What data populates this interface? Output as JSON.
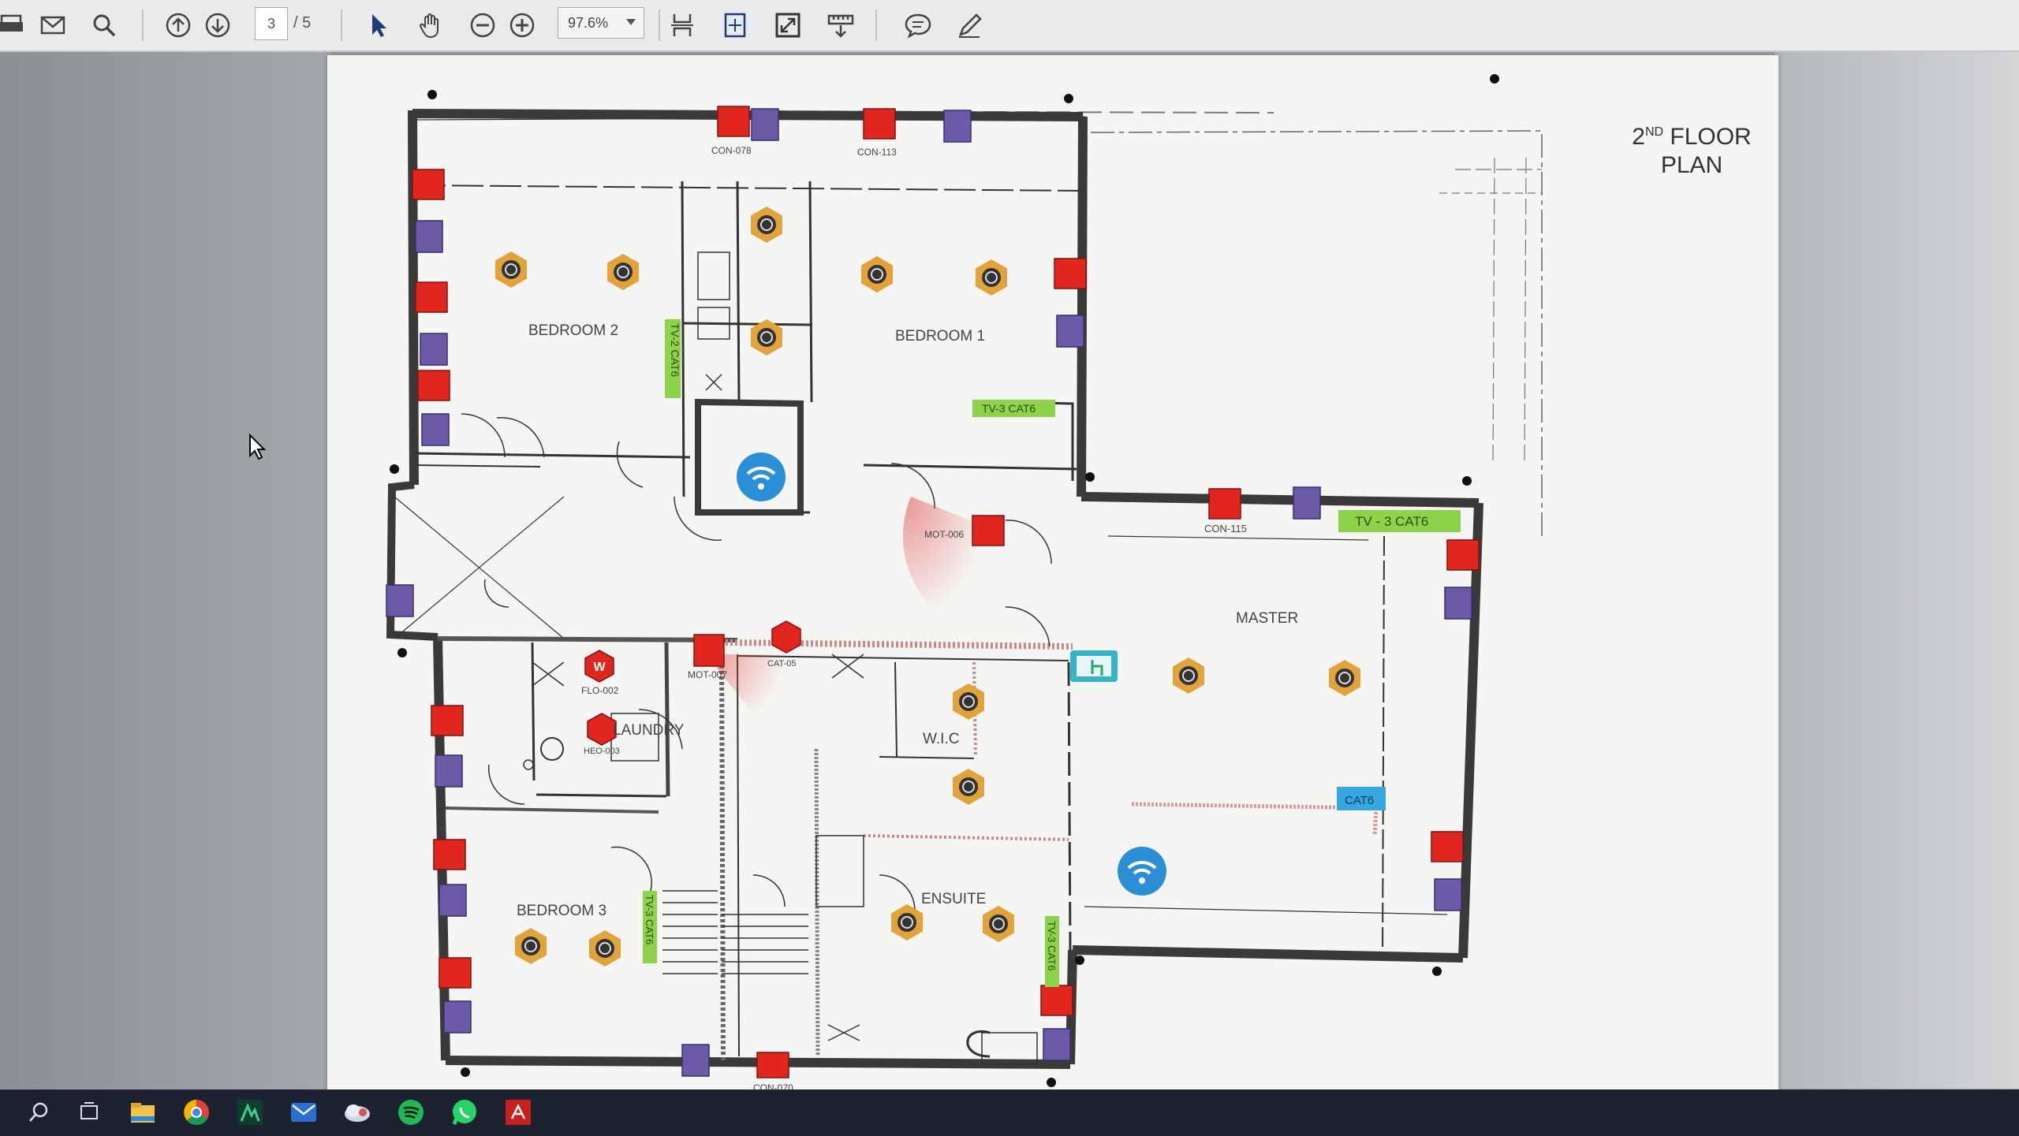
{
  "toolbar": {
    "page_current": "3",
    "page_total": "/ 5",
    "zoom": "97.6%",
    "icons": [
      "print-icon",
      "email-icon",
      "search-icon",
      "page-up-icon",
      "page-down-icon",
      "select-arrow-icon",
      "hand-icon",
      "zoom-out-icon",
      "zoom-in-icon",
      "fit-width-icon",
      "fit-page-icon",
      "fullscreen-icon",
      "measure-icon",
      "comment-icon",
      "pen-icon"
    ]
  },
  "plan": {
    "title_line1": "2",
    "title_sup": "ND",
    "title_line1_rest": " FLOOR",
    "title_line2": "PLAN",
    "rooms": {
      "bedroom2": "BEDROOM 2",
      "bedroom1": "BEDROOM 1",
      "master": "MASTER",
      "laundry": "LAUNDRY",
      "wic": "W.I.C",
      "ensuite": "ENSUITE",
      "bedroom3": "BEDROOM 3"
    },
    "green_labels": {
      "tv2": "TV-2 CAT6",
      "tv3_top": "TV-3 CAT6",
      "tv3_master": "TV - 3 CAT6",
      "tv_b3": "TV-3 CAT6",
      "tv_ensuite": "TV-3 CAT6"
    },
    "blue_label": "CAT6",
    "device_labels": {
      "con078": "CON-078",
      "con113": "CON-113",
      "con115": "CON-115",
      "con070": "CON-070",
      "mot006": "MOT-006",
      "mot007": "MOT-007",
      "flo002": "FLO-002",
      "heo003": "HEO-003",
      "cat_sm": "CAT-05"
    },
    "colors": {
      "device_red": "#e0261f",
      "device_purple": "#6c59a8",
      "tv_green": "#8dd34a",
      "wifi_blue": "#2a8fd6",
      "speaker_orange": "#e2a33a"
    }
  },
  "taskbar": {
    "icons": [
      "search-icon",
      "task-view-icon",
      "file-explorer-icon",
      "chrome-icon",
      "app-icon",
      "mail-icon",
      "cloud-icon",
      "spotify-icon",
      "whatsapp-icon",
      "acrobat-icon"
    ]
  }
}
